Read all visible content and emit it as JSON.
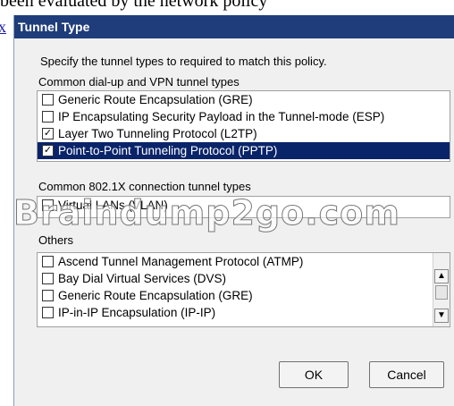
{
  "background": {
    "top_text": "been evaluated by the network policy",
    "link_text": "x"
  },
  "dialog": {
    "title": "Tunnel Type",
    "instruction": "Specify the tunnel types to required to match this policy.",
    "groups": {
      "common": {
        "label": "Common dial-up and VPN tunnel types",
        "items": [
          {
            "label": "Generic Route Encapsulation (GRE)",
            "checked": false,
            "selected": false
          },
          {
            "label": "IP Encapsulating Security Payload in the Tunnel-mode (ESP)",
            "checked": false,
            "selected": false
          },
          {
            "label": "Layer Two Tunneling Protocol (L2TP)",
            "checked": true,
            "selected": false
          },
          {
            "label": "Point-to-Point Tunneling Protocol (PPTP)",
            "checked": true,
            "selected": true
          }
        ]
      },
      "dot1x": {
        "label": "Common 802.1X connection tunnel types",
        "items": [
          {
            "label": "Virtual LANs (VLAN)",
            "checked": false,
            "selected": false
          }
        ]
      },
      "others": {
        "label": "Others",
        "items": [
          {
            "label": "Ascend Tunnel Management Protocol (ATMP)",
            "checked": false,
            "selected": false
          },
          {
            "label": "Bay Dial Virtual Services (DVS)",
            "checked": false,
            "selected": false
          },
          {
            "label": "Generic Route Encapsulation (GRE)",
            "checked": false,
            "selected": false
          },
          {
            "label": "IP-in-IP Encapsulation (IP-IP)",
            "checked": false,
            "selected": false
          }
        ]
      }
    },
    "buttons": {
      "ok": "OK",
      "cancel": "Cancel"
    }
  },
  "watermark": "Braindump2go.com",
  "colors": {
    "titlebar": "#1f3d7a",
    "selection": "#0a246a",
    "dialog_bg": "#f0f0f0"
  }
}
